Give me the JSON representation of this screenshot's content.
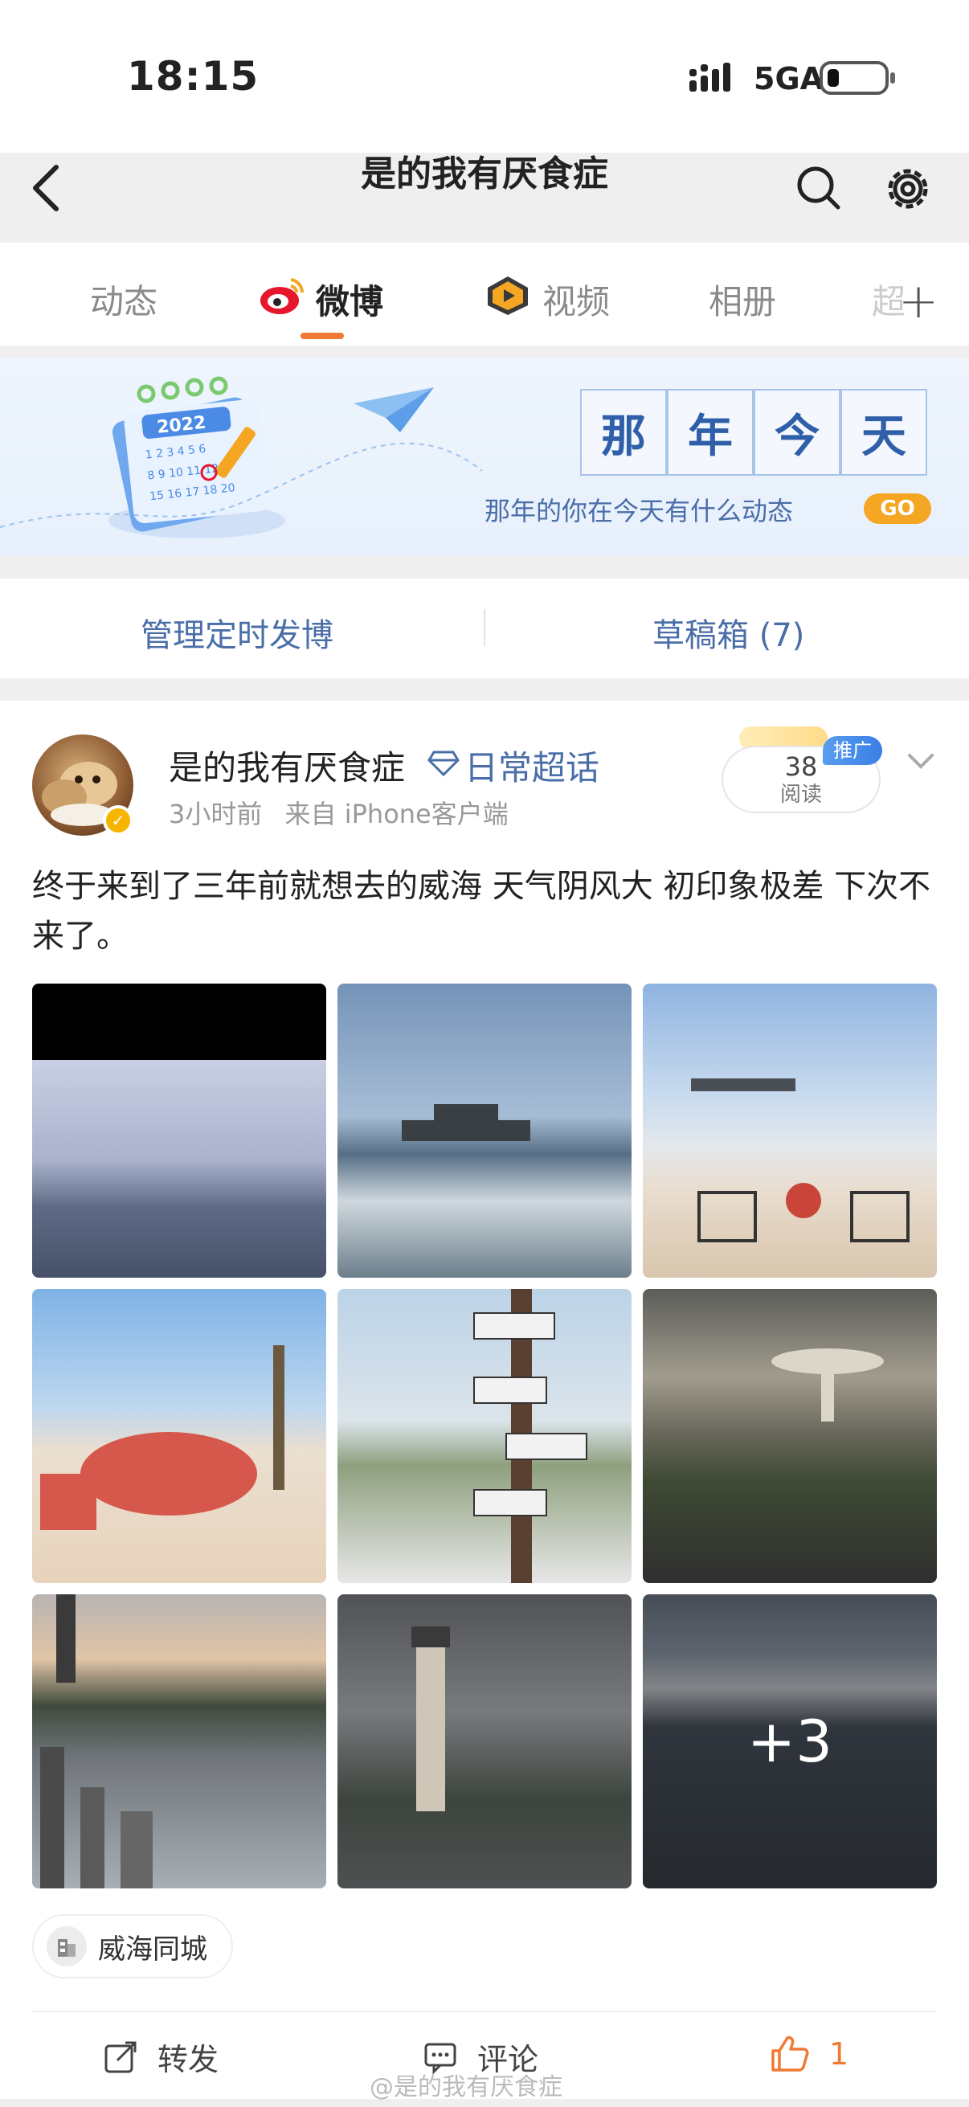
{
  "status_bar": {
    "time": "18:15",
    "network": "5GA"
  },
  "nav": {
    "title": "是的我有厌食症"
  },
  "tabs": [
    {
      "label": "动态"
    },
    {
      "label": "微博"
    },
    {
      "label": "视频"
    },
    {
      "label": "相册"
    },
    {
      "label": "超"
    }
  ],
  "banner": {
    "title_chars": [
      "那",
      "年",
      "今",
      "天"
    ],
    "subtitle": "那年的你在今天有什么动态",
    "go": "GO",
    "calendar_year": "2022"
  },
  "actions": {
    "scheduled": "管理定时发博",
    "drafts": "草稿箱 (7)"
  },
  "post": {
    "username": "是的我有厌食症",
    "topic": "日常超话",
    "time": "3小时前",
    "source": "来自 iPhone客户端",
    "reads_count": "38",
    "reads_label": "阅读",
    "promo": "推广",
    "text": "终于来到了三年前就想去的威海 天气阴风大 初印象极差 下次不来了。",
    "more_photos": "+3",
    "location": "威海同城",
    "repost": "转发",
    "comment": "评论",
    "likes": "1",
    "watermark": "@是的我有厌食症"
  },
  "colors": {
    "accent": "#f07a33",
    "link": "#4a6ea8",
    "promo": "#3a7fe6"
  }
}
